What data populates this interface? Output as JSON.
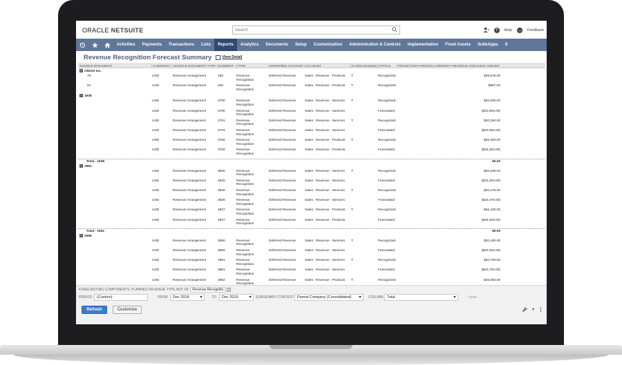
{
  "header": {
    "logo_text": "ORACLE",
    "logo_bold": "NETSUITE",
    "search_placeholder": "Search",
    "help_label": "Help",
    "feedback_label": "Feedback"
  },
  "nav": {
    "items": [
      "Activities",
      "Payments",
      "Transactions",
      "Lists",
      "Reports",
      "Analytics",
      "Documents",
      "Setup",
      "Customization",
      "Administration & Controls",
      "Implementation",
      "Fixed Assets",
      "SuiteApps",
      "S"
    ],
    "active_index": 4
  },
  "page": {
    "title": "Revenue Recognition Forecast Summary",
    "view_detail": "View Detail"
  },
  "table": {
    "headers": [
      "Source Document",
      "Currency",
      "Source Document Type",
      "Element",
      "Type",
      "Deferred Account",
      "Account",
      "Is Recognized",
      "Status",
      "Projected Foreign Currency Revenue Variance",
      "Amount"
    ],
    "rows": [
      {
        "kind": "group",
        "label": "Abbott Inc.",
        "expander": "⊟"
      },
      {
        "kind": "data",
        "doc": "78",
        "cur": "USD",
        "dtype": "Revenue Arrangement",
        "el": "195",
        "type": "Revenue Recognition",
        "def": "Deferred Revenue",
        "acct": "Sales : Revenue - Products",
        "rec": "T",
        "status": "Recognized",
        "amt": "$39,975.00"
      },
      {
        "kind": "data",
        "doc": "91",
        "cur": "USD",
        "dtype": "Revenue Arrangement",
        "el": "200",
        "type": "Revenue Recognition",
        "def": "Deferred Revenue",
        "acct": "Sales : Revenue - Products",
        "rec": "T",
        "status": "Recognized",
        "amt": "$987.00"
      },
      {
        "kind": "subgroup",
        "label": "1938",
        "expander": "⊞"
      },
      {
        "kind": "data",
        "doc": "",
        "cur": "USD",
        "dtype": "Revenue Arrangement",
        "el": "3790",
        "type": "Revenue Recognition",
        "def": "Deferred Revenue",
        "acct": "Sales : Revenue - Services",
        "rec": "T",
        "status": "Recognized",
        "amt": "$20,000.00"
      },
      {
        "kind": "data",
        "doc": "",
        "cur": "USD",
        "dtype": "Revenue Arrangement",
        "el": "3790",
        "type": "Revenue Recognition",
        "def": "Deferred Revenue",
        "acct": "Sales : Revenue - Services",
        "rec": "",
        "status": "Forecasted",
        "amt": "($20,000.00)"
      },
      {
        "kind": "data",
        "doc": "",
        "cur": "USD",
        "dtype": "Revenue Arrangement",
        "el": "3791",
        "type": "Revenue Recognition",
        "def": "Deferred Revenue",
        "acct": "Sales : Revenue - Services",
        "rec": "T",
        "status": "Recognized",
        "amt": "$20,250.00"
      },
      {
        "kind": "data",
        "doc": "",
        "cur": "USD",
        "dtype": "Revenue Arrangement",
        "el": "3791",
        "type": "Revenue Recognition",
        "def": "Deferred Revenue",
        "acct": "Sales : Revenue - Services",
        "rec": "",
        "status": "Forecasted",
        "amt": "($20,250.00)"
      },
      {
        "kind": "data",
        "doc": "",
        "cur": "USD",
        "dtype": "Revenue Arrangement",
        "el": "3792",
        "type": "Revenue Recognition",
        "def": "Deferred Revenue",
        "acct": "Sales : Revenue - Products",
        "rec": "T",
        "status": "Recognized",
        "amt": "$26,250.00"
      },
      {
        "kind": "data",
        "doc": "",
        "cur": "USD",
        "dtype": "Revenue Arrangement",
        "el": "3792",
        "type": "Revenue Recognition",
        "def": "Deferred Revenue",
        "acct": "Sales : Revenue - Products",
        "rec": "",
        "status": "Forecasted",
        "amt": "($26,250.00)"
      },
      {
        "kind": "total",
        "label": "Total - 1938",
        "amt": "$0.00"
      },
      {
        "kind": "subgroup",
        "label": "1951",
        "expander": "⊞"
      },
      {
        "kind": "data",
        "doc": "",
        "cur": "USD",
        "dtype": "Revenue Arrangement",
        "el": "3825",
        "type": "Revenue Recognition",
        "def": "Deferred Revenue",
        "acct": "Sales : Revenue - Services",
        "rec": "T",
        "status": "Recognized",
        "amt": "$20,200.00"
      },
      {
        "kind": "data",
        "doc": "",
        "cur": "USD",
        "dtype": "Revenue Arrangement",
        "el": "3825",
        "type": "Revenue Recognition",
        "def": "Deferred Revenue",
        "acct": "Sales : Revenue - Services",
        "rec": "",
        "status": "Forecasted",
        "amt": "($20,200.00)"
      },
      {
        "kind": "data",
        "doc": "",
        "cur": "USD",
        "dtype": "Revenue Arrangement",
        "el": "3826",
        "type": "Revenue Recognition",
        "def": "Deferred Revenue",
        "acct": "Sales : Revenue - Services",
        "rec": "T",
        "status": "Recognized",
        "amt": "$20,475.00"
      },
      {
        "kind": "data",
        "doc": "",
        "cur": "USD",
        "dtype": "Revenue Arrangement",
        "el": "3826",
        "type": "Revenue Recognition",
        "def": "Deferred Revenue",
        "acct": "Sales : Revenue - Services",
        "rec": "",
        "status": "Forecasted",
        "amt": "($20,475.00)"
      },
      {
        "kind": "data",
        "doc": "",
        "cur": "USD",
        "dtype": "Revenue Arrangement",
        "el": "3827",
        "type": "Revenue Recognition",
        "def": "Deferred Revenue",
        "acct": "Sales : Revenue - Products",
        "rec": "T",
        "status": "Recognized",
        "amt": "$26,400.00"
      },
      {
        "kind": "data",
        "doc": "",
        "cur": "USD",
        "dtype": "Revenue Arrangement",
        "el": "3827",
        "type": "Revenue Recognition",
        "def": "Deferred Revenue",
        "acct": "Sales : Revenue - Products",
        "rec": "",
        "status": "Forecasted",
        "amt": "($26,400.00)"
      },
      {
        "kind": "total",
        "label": "Total - 1951",
        "amt": "$0.00"
      },
      {
        "kind": "subgroup",
        "label": "1966",
        "expander": "⊞"
      },
      {
        "kind": "data",
        "doc": "",
        "cur": "USD",
        "dtype": "Revenue Arrangement",
        "el": "3860",
        "type": "Revenue Recognition",
        "def": "Deferred Revenue",
        "acct": "Sales : Revenue - Services",
        "rec": "T",
        "status": "Recognized",
        "amt": "$20,400.00"
      },
      {
        "kind": "data",
        "doc": "",
        "cur": "USD",
        "dtype": "Revenue Arrangement",
        "el": "3860",
        "type": "Revenue Recognition",
        "def": "Deferred Revenue",
        "acct": "Sales : Revenue - Services",
        "rec": "",
        "status": "Forecasted",
        "amt": "($20,400.00)"
      },
      {
        "kind": "data",
        "doc": "",
        "cur": "USD",
        "dtype": "Revenue Arrangement",
        "el": "3861",
        "type": "Revenue Recognition",
        "def": "Deferred Revenue",
        "acct": "Sales : Revenue - Services",
        "rec": "T",
        "status": "Recognized",
        "amt": "$20,700.00"
      },
      {
        "kind": "data",
        "doc": "",
        "cur": "USD",
        "dtype": "Revenue Arrangement",
        "el": "3861",
        "type": "Revenue Recognition",
        "def": "Deferred Revenue",
        "acct": "Sales : Revenue - Services",
        "rec": "",
        "status": "Forecasted",
        "amt": "($20,700.00)"
      },
      {
        "kind": "data",
        "doc": "",
        "cur": "USD",
        "dtype": "Revenue Arrangement",
        "el": "3862",
        "type": "Revenue Recognition",
        "def": "Deferred Revenue",
        "acct": "Sales : Revenue - Products",
        "rec": "T",
        "status": "Recognized",
        "amt": "$26,550.00"
      }
    ]
  },
  "filters": {
    "forecasting_label": "Forecasting Components: Planned Revenue Type Any of",
    "forecasting_value": "Revenue Recognitio",
    "period_label": "Period",
    "period_value": "(Custom)",
    "from_label": "From",
    "from_value": "Dec 2018",
    "to_label": "To",
    "to_value": "Dec 2019",
    "subsidiary_label": "Subsidiary Context",
    "subsidiary_value": "Parent Company (Consolidated)",
    "column_label": "Column",
    "column_value": "Total",
    "less_label": "LESS",
    "refresh_label": "Refresh",
    "customize_label": "Customize"
  },
  "colors": {
    "nav_bg": "#607799",
    "nav_active": "#2f4a70",
    "title": "#4d5f7a",
    "refresh_bg": "#3a7bd5"
  }
}
